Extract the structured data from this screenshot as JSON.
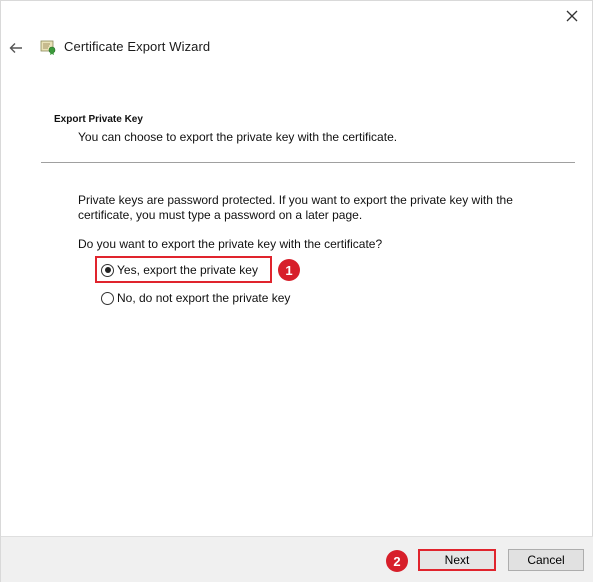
{
  "window": {
    "title": "Certificate Export Wizard",
    "close_icon": "close-icon",
    "back_icon": "back-arrow-icon",
    "app_icon": "certificate-icon"
  },
  "page": {
    "heading": "Export Private Key",
    "subtitle": "You can choose to export the private key with the certificate.",
    "info": "Private keys are password protected. If you want to export the private key with the certificate, you must type a password on a later page.",
    "question": "Do you want to export the private key with the certificate?"
  },
  "options": {
    "yes_label": "Yes, export the private key",
    "yes_selected": true,
    "no_label": "No, do not export the private key",
    "no_selected": false
  },
  "annotations": {
    "step1": "1",
    "step2": "2",
    "highlight_color": "#e0242d",
    "badge_color": "#d71f2a"
  },
  "footer": {
    "next_label": "Next",
    "cancel_label": "Cancel"
  }
}
